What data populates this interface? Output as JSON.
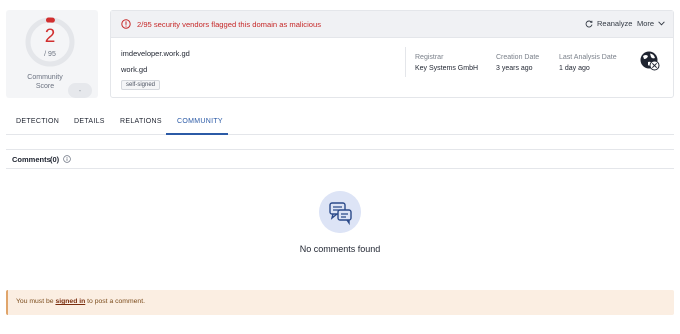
{
  "score": {
    "detections": "2",
    "total": "/ 95",
    "community_label": "Community Score",
    "community_value": "-",
    "color": "#d12f2f"
  },
  "alert": {
    "text": "2/95 security vendors flagged this domain as malicious",
    "icon": "alert-circle-icon",
    "color": "#c62828"
  },
  "actions": {
    "reanalyze": "Reanalyze",
    "more": "More"
  },
  "domain": {
    "name": "imdeveloper.work.gd",
    "parent": "work.gd",
    "tag": "self-signed"
  },
  "meta": {
    "registrar_label": "Registrar",
    "registrar_value": "Key Systems GmbH",
    "creation_label": "Creation Date",
    "creation_value": "3 years ago",
    "analysis_label": "Last Analysis Date",
    "analysis_value": "1 day ago"
  },
  "tabs": [
    {
      "label": "DETECTION",
      "active": false
    },
    {
      "label": "DETAILS",
      "active": false
    },
    {
      "label": "RELATIONS",
      "active": false
    },
    {
      "label": "COMMUNITY",
      "active": true
    }
  ],
  "accent": "#2b5aa6",
  "comments": {
    "title": "Comments",
    "count": "(0)",
    "empty": "No comments found"
  },
  "signin": {
    "prefix": "You must be ",
    "link": "signed in",
    "suffix": " to post a comment."
  }
}
